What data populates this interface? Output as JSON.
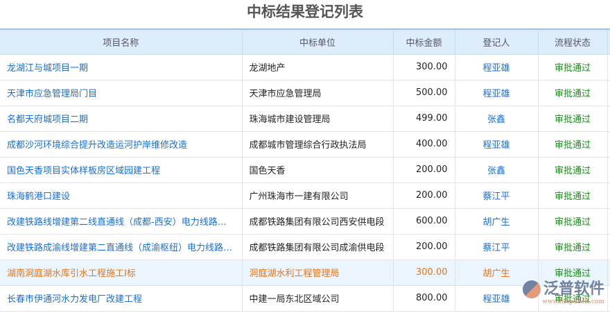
{
  "title": "中标结果登记列表",
  "columns": [
    "项目名称",
    "中标单位",
    "中标金额",
    "登记人",
    "流程状态"
  ],
  "rows": [
    {
      "name": "龙湖江与城项目一期",
      "unit": "龙湖地产",
      "amount": "300.00",
      "person": "程亚雄",
      "status": "审批通过"
    },
    {
      "name": "天津市应急管理局门目",
      "unit": "天津市应急管理局",
      "amount": "500.00",
      "person": "程亚雄",
      "status": "审批通过"
    },
    {
      "name": "名都天府城项目二期",
      "unit": "珠海城市建设管理局",
      "amount": "499.00",
      "person": "张鑫",
      "status": "审批通过"
    },
    {
      "name": "成都沙河环境综合提升改造运河护岸维修改造",
      "unit": "成都城市管理综合行政执法局",
      "amount": "400.00",
      "person": "程亚雄",
      "status": "审批通过"
    },
    {
      "name": "国色天香项目实体样板房区域园建工程",
      "unit": "国色天香",
      "amount": "200.00",
      "person": "张鑫",
      "status": "审批通过"
    },
    {
      "name": "珠海鹤港口建设",
      "unit": "广州珠海市一建有限公司",
      "amount": "200.00",
      "person": "蔡江平",
      "status": "审批通过"
    },
    {
      "name": "改建铁路线增建第二线直通线（成都-西安）电力线路迁改工程",
      "unit": "成都铁路集团有限公司西安供电段",
      "amount": "600.00",
      "person": "胡广生",
      "status": "审批通过"
    },
    {
      "name": "改建铁路成渝线增建第二直通线（成渝枢纽）电力线路迁改工程",
      "unit": "成都铁路集团有限公司成渝供电段",
      "amount": "200.00",
      "person": "蔡江平",
      "status": "审批通过"
    },
    {
      "name": "湖南洞庭湖水库引水工程施工I标",
      "unit": "洞庭湖水利工程管理局",
      "amount": "300.00",
      "person": "胡广生",
      "status": "审批通过"
    },
    {
      "name": "长春市伊通河水力发电厂改建工程",
      "unit": "中建一局东北区域公司",
      "amount": "800.00",
      "person": "程亚雄",
      "status": "审批通过"
    }
  ],
  "logo": {
    "text": "泛普软件",
    "url": "www.fanpusoft.com"
  }
}
